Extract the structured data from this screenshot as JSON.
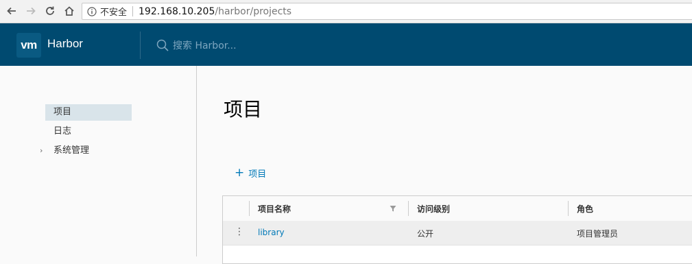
{
  "browser": {
    "security_label": "不安全",
    "url_host": "192.168.10.205",
    "url_path": "/harbor/projects"
  },
  "header": {
    "logo_text": "vm",
    "app_name": "Harbor",
    "search_placeholder": "搜索 Harbor..."
  },
  "sidebar": {
    "items": [
      {
        "label": "项目",
        "active": true
      },
      {
        "label": "日志",
        "active": false
      },
      {
        "label": "系统管理",
        "active": false,
        "expandable": true
      }
    ]
  },
  "main": {
    "title": "项目",
    "add_button_label": "项目",
    "table": {
      "columns": [
        "项目名称",
        "访问级别",
        "角色"
      ],
      "rows": [
        {
          "name": "library",
          "access": "公开",
          "role": "项目管理员"
        }
      ]
    }
  },
  "colors": {
    "header_bg": "#004a70",
    "link": "#0079b8",
    "active_nav_bg": "#d9e4ea"
  }
}
